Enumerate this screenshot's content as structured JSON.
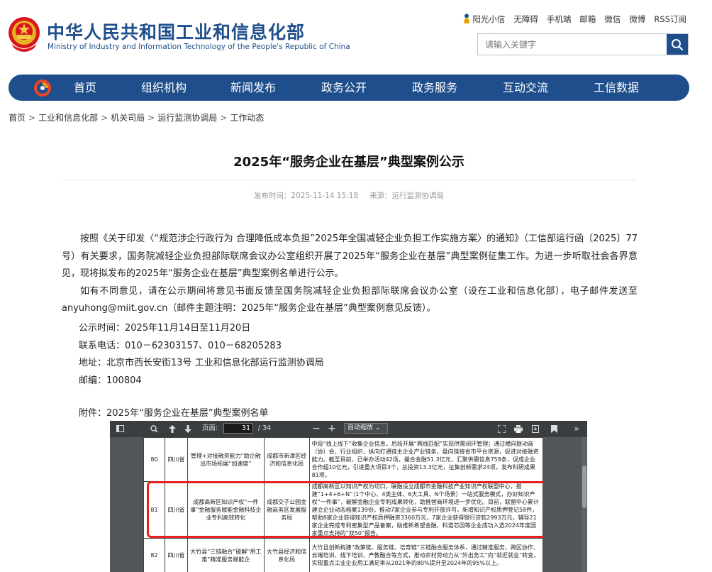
{
  "site": {
    "title_cn": "中华人民共和国工业和信息化部",
    "title_en": "Ministry of Industry and Information Technology of the People's Republic of China",
    "top_links": [
      "阳光小信",
      "无障碍",
      "手机端",
      "邮箱",
      "微信",
      "微博",
      "RSS订阅"
    ],
    "search_placeholder": "请输入关键字"
  },
  "nav": {
    "items": [
      "首页",
      "组织机构",
      "新闻发布",
      "政务公开",
      "政务服务",
      "互动交流",
      "工信数据"
    ]
  },
  "breadcrumb": [
    "首页",
    "工业和信息化部",
    "机关司局",
    "运行监测协调局",
    "工作动态"
  ],
  "article": {
    "title": "2025年“服务企业在基层”典型案例公示",
    "publish_time": "发布时间：2025-11-14 15:18",
    "source": "来源：运行监测协调局",
    "paragraphs": [
      "按照《关于印发〈“规范涉企行政行为 合理降低成本负担”2025年全国减轻企业负担工作实施方案〉的通知》（工信部运行函〔2025〕77号）有关要求，国务院减轻企业负担部际联席会议办公室组织开展了2025年“服务企业在基层”典型案例征集工作。为进一步听取社会各界意见，现将拟发布的2025年“服务企业在基层”典型案例名单进行公示。",
      "如有不同意见，请在公示期间将意见书面反馈至国务院减轻企业负担部际联席会议办公室（设在工业和信息化部），电子邮件发送至anyuhong@miit.gov.cn（邮件主题注明：2025年“服务企业在基层”典型案例意见反馈）。"
    ],
    "period": "公示时间：2025年11月14日至11月20日",
    "phone": "联系电话：010－62303157、010－68205283",
    "address": "地址：北京市西长安街13号 工业和信息化部运行监测协调局",
    "postcode": "邮编：100804",
    "attachment": "附件：2025年“服务企业在基层”典型案例名单"
  },
  "pdf_viewer": {
    "page_label": "页面:",
    "current_page": "31",
    "total_pages": "/ 34",
    "zoom": "自动缩放",
    "rows": [
      {
        "no": "80",
        "province": "四川省",
        "name": "管理+对接融资能力”助企融出市场拓展“加速度”",
        "unit": "成都市新津区经济和信息化局",
        "desc": "中段“线上线下”收集企业信息，后段开展“两线匹配”实现供需闭环管理；通过横向联动商（协）会、行业组织，纵向打通链主企业产业链条，盘向链接省市平台资源，促进对接融资能力。截至目前，已举办活动42场，撮合金融51.3亿元，汇聚供需信息758条，促成企业合作超10亿元，引进重大项目3个，总投资13.3亿元，征集创新需求24项，发布科研成果81项。"
      },
      {
        "no": "81",
        "province": "四川省",
        "name": "成都高新区知识产权“一件事”金融服务赋能金融科技企业专利高效转化",
        "unit": "成都交子公园金融商务区发展服务局",
        "desc": "成都高新区以知识产权为切口，联融设立成都市金融科技产业知识产权联盟中心，搭建“1+4+6+N”（1个中心、4类主体、6大工具、N个场景）一站式服务模式，办好知识产权“一件事”，破解金融企业专利成果转化，助推营商环境进一步优化。目前，联盟中心累计建立企业动态档案139份，推动7家企业参与专利开放许可，新增知识产权质押登记58件，帮助8家企业获得知识产权质押融资3360万元，7家企业获得银行贷款2993万元，辅导21家企业完成专利密集型产品备案，助推新希望金融、科道芯国等企业成功入选2024年度国家重点支持的“双50”报告。"
      },
      {
        "no": "82",
        "province": "四川省",
        "name": "大竹县“三链融合”破解“用工难”精准服务赋能企",
        "unit": "大竹县经济和信息化局",
        "desc": "大竹县创新构建“政策链、服务链、培育链”三链融合服务体系，通过精准服务、跨区协作、云端培训、线下培训、产教融合等方式，推动农村劳动力从“外出务工”向“就近就业”转变，实现重点工业企业用工满足率从2021年的80%提升至2024年的95%以上。"
      }
    ]
  }
}
